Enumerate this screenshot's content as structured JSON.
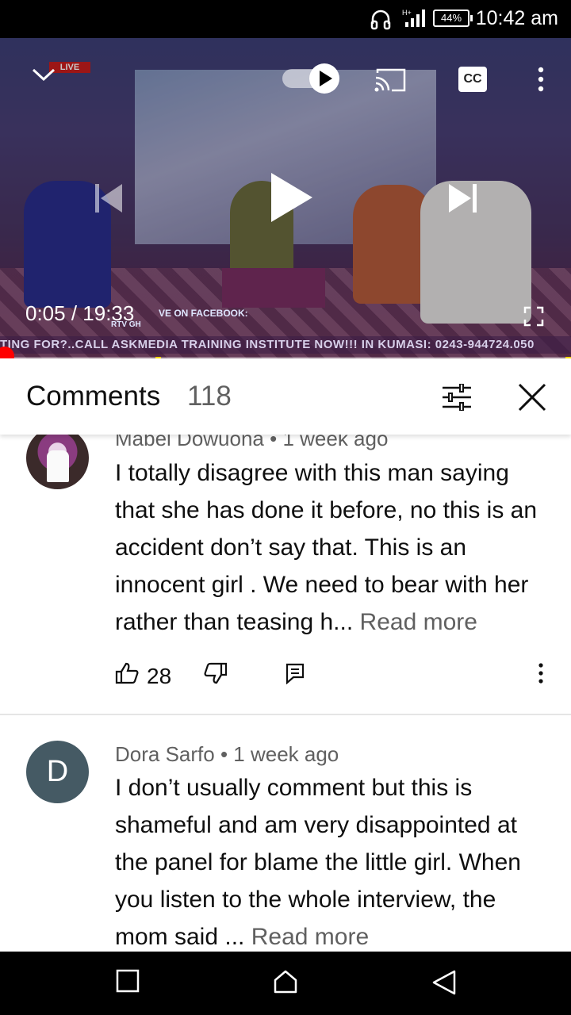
{
  "status_bar": {
    "battery": "44%",
    "time": "10:42 am"
  },
  "player": {
    "live_badge": "LIVE",
    "cc_label": "CC",
    "current_time": "0:05",
    "duration": "19:33",
    "time_separator": " / ",
    "timecode": "0:05 / 19:33",
    "ticker": "TING FOR?..CALL ASKMEDIA TRAINING INSTITUTE NOW!!! IN KUMASI: 0243-944724.050",
    "ticker_overlay": "VE ON FACEBOOK:",
    "channel": "RTV GH",
    "progress_fraction": 0.0043,
    "ad_markers": [
      0.272,
      0.99
    ],
    "accent_color": "#ff0000"
  },
  "comments_panel": {
    "title": "Comments",
    "count": "118",
    "items": [
      {
        "author": "Mabel Dowuona",
        "age": "1 week ago",
        "meta": "Mabel Dowuona • 1 week ago",
        "text": "I totally disagree with this man saying that she has done it before, no this is an accident don’t say that. This is an innocent girl . We need to bear with her rather than teasing h...",
        "read_more": "Read more",
        "likes": "28",
        "avatar_type": "photo"
      },
      {
        "author": "Dora Sarfo",
        "age": "1 week ago",
        "meta": "Dora Sarfo • 1 week ago",
        "text": "I don’t usually comment but this is shameful and am very disappointed at the panel for blame the little girl. When you listen to the whole interview, the mom said ...",
        "read_more": "Read more",
        "avatar_letter": "D",
        "avatar_color": "#455a64"
      }
    ]
  },
  "icons": {
    "collapse": "chevron-down-icon",
    "autoplay": "autoplay-toggle-icon",
    "cast": "cast-icon",
    "more": "more-vert-icon",
    "previous": "skip-previous-icon",
    "play": "play-icon",
    "next": "skip-next-icon",
    "fullscreen": "fullscreen-icon",
    "sort": "sort-filter-icon",
    "close": "close-icon",
    "like": "thumbs-up-icon",
    "dislike": "thumbs-down-icon",
    "reply": "reply-icon",
    "nav_recents": "recents-square-icon",
    "nav_home": "home-icon",
    "nav_back": "back-triangle-icon"
  }
}
